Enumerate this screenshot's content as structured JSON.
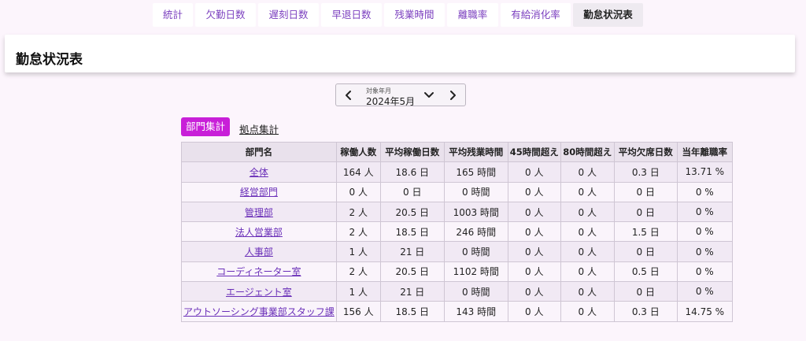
{
  "tabs": [
    {
      "label": "統計",
      "active": false
    },
    {
      "label": "欠勤日数",
      "active": false
    },
    {
      "label": "遅刻日数",
      "active": false
    },
    {
      "label": "早退日数",
      "active": false
    },
    {
      "label": "残業時間",
      "active": false
    },
    {
      "label": "離職率",
      "active": false
    },
    {
      "label": "有給消化率",
      "active": false
    },
    {
      "label": "勤怠状況表",
      "active": true
    }
  ],
  "page": {
    "title": "勤怠状況表"
  },
  "month_picker": {
    "label": "対象年月",
    "value": "2024年5月",
    "prev_icon": "chevron-left-icon",
    "dropdown_icon": "chevron-down-icon",
    "next_icon": "chevron-right-icon"
  },
  "view_toggle": {
    "department": "部門集計",
    "location": "拠点集計"
  },
  "table": {
    "headers": [
      "部門名",
      "稼働人数",
      "平均稼働日数",
      "平均残業時間",
      "45時間超え",
      "80時間超え",
      "平均欠席日数",
      "当年離職率"
    ],
    "rows": [
      [
        "全体",
        "164 人",
        "18.6 日",
        "165 時間",
        "0 人",
        "0 人",
        "0.3 日",
        "13.71 %"
      ],
      [
        "経営部門",
        "0 人",
        "0 日",
        "0 時間",
        "0 人",
        "0 人",
        "0 日",
        "0 %"
      ],
      [
        "管理部",
        "2 人",
        "20.5 日",
        "1003 時間",
        "0 人",
        "0 人",
        "0 日",
        "0 %"
      ],
      [
        "法人営業部",
        "2 人",
        "18.5 日",
        "246 時間",
        "0 人",
        "0 人",
        "1.5 日",
        "0 %"
      ],
      [
        "人事部",
        "1 人",
        "21 日",
        "0 時間",
        "0 人",
        "0 人",
        "0 日",
        "0 %"
      ],
      [
        "コーディネーター室",
        "2 人",
        "20.5 日",
        "1102 時間",
        "0 人",
        "0 人",
        "0.5 日",
        "0 %"
      ],
      [
        "エージェント室",
        "1 人",
        "21 日",
        "0 時間",
        "0 人",
        "0 人",
        "0 日",
        "0 %"
      ],
      [
        "アウトソーシング事業部スタッフ課",
        "156 人",
        "18.5 日",
        "143 時間",
        "0 人",
        "0 人",
        "0.3 日",
        "14.75 %"
      ]
    ]
  },
  "colors": {
    "accent": "#c81fd8",
    "link": "#6a2fb8",
    "tab_text": "#7b3fbf"
  }
}
